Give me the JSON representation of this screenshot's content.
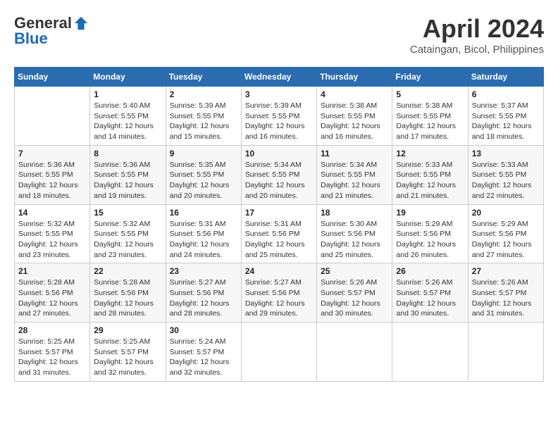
{
  "header": {
    "logo_general": "General",
    "logo_blue": "Blue",
    "month_year": "April 2024",
    "location": "Cataingan, Bicol, Philippines"
  },
  "days_of_week": [
    "Sunday",
    "Monday",
    "Tuesday",
    "Wednesday",
    "Thursday",
    "Friday",
    "Saturday"
  ],
  "weeks": [
    [
      {
        "num": "",
        "detail": ""
      },
      {
        "num": "1",
        "detail": "Sunrise: 5:40 AM\nSunset: 5:55 PM\nDaylight: 12 hours\nand 14 minutes."
      },
      {
        "num": "2",
        "detail": "Sunrise: 5:39 AM\nSunset: 5:55 PM\nDaylight: 12 hours\nand 15 minutes."
      },
      {
        "num": "3",
        "detail": "Sunrise: 5:39 AM\nSunset: 5:55 PM\nDaylight: 12 hours\nand 16 minutes."
      },
      {
        "num": "4",
        "detail": "Sunrise: 5:38 AM\nSunset: 5:55 PM\nDaylight: 12 hours\nand 16 minutes."
      },
      {
        "num": "5",
        "detail": "Sunrise: 5:38 AM\nSunset: 5:55 PM\nDaylight: 12 hours\nand 17 minutes."
      },
      {
        "num": "6",
        "detail": "Sunrise: 5:37 AM\nSunset: 5:55 PM\nDaylight: 12 hours\nand 18 minutes."
      }
    ],
    [
      {
        "num": "7",
        "detail": "Sunrise: 5:36 AM\nSunset: 5:55 PM\nDaylight: 12 hours\nand 18 minutes."
      },
      {
        "num": "8",
        "detail": "Sunrise: 5:36 AM\nSunset: 5:55 PM\nDaylight: 12 hours\nand 19 minutes."
      },
      {
        "num": "9",
        "detail": "Sunrise: 5:35 AM\nSunset: 5:55 PM\nDaylight: 12 hours\nand 20 minutes."
      },
      {
        "num": "10",
        "detail": "Sunrise: 5:34 AM\nSunset: 5:55 PM\nDaylight: 12 hours\nand 20 minutes."
      },
      {
        "num": "11",
        "detail": "Sunrise: 5:34 AM\nSunset: 5:55 PM\nDaylight: 12 hours\nand 21 minutes."
      },
      {
        "num": "12",
        "detail": "Sunrise: 5:33 AM\nSunset: 5:55 PM\nDaylight: 12 hours\nand 21 minutes."
      },
      {
        "num": "13",
        "detail": "Sunrise: 5:33 AM\nSunset: 5:55 PM\nDaylight: 12 hours\nand 22 minutes."
      }
    ],
    [
      {
        "num": "14",
        "detail": "Sunrise: 5:32 AM\nSunset: 5:55 PM\nDaylight: 12 hours\nand 23 minutes."
      },
      {
        "num": "15",
        "detail": "Sunrise: 5:32 AM\nSunset: 5:55 PM\nDaylight: 12 hours\nand 23 minutes."
      },
      {
        "num": "16",
        "detail": "Sunrise: 5:31 AM\nSunset: 5:56 PM\nDaylight: 12 hours\nand 24 minutes."
      },
      {
        "num": "17",
        "detail": "Sunrise: 5:31 AM\nSunset: 5:56 PM\nDaylight: 12 hours\nand 25 minutes."
      },
      {
        "num": "18",
        "detail": "Sunrise: 5:30 AM\nSunset: 5:56 PM\nDaylight: 12 hours\nand 25 minutes."
      },
      {
        "num": "19",
        "detail": "Sunrise: 5:29 AM\nSunset: 5:56 PM\nDaylight: 12 hours\nand 26 minutes."
      },
      {
        "num": "20",
        "detail": "Sunrise: 5:29 AM\nSunset: 5:56 PM\nDaylight: 12 hours\nand 27 minutes."
      }
    ],
    [
      {
        "num": "21",
        "detail": "Sunrise: 5:28 AM\nSunset: 5:56 PM\nDaylight: 12 hours\nand 27 minutes."
      },
      {
        "num": "22",
        "detail": "Sunrise: 5:28 AM\nSunset: 5:56 PM\nDaylight: 12 hours\nand 28 minutes."
      },
      {
        "num": "23",
        "detail": "Sunrise: 5:27 AM\nSunset: 5:56 PM\nDaylight: 12 hours\nand 28 minutes."
      },
      {
        "num": "24",
        "detail": "Sunrise: 5:27 AM\nSunset: 5:56 PM\nDaylight: 12 hours\nand 29 minutes."
      },
      {
        "num": "25",
        "detail": "Sunrise: 5:26 AM\nSunset: 5:57 PM\nDaylight: 12 hours\nand 30 minutes."
      },
      {
        "num": "26",
        "detail": "Sunrise: 5:26 AM\nSunset: 5:57 PM\nDaylight: 12 hours\nand 30 minutes."
      },
      {
        "num": "27",
        "detail": "Sunrise: 5:26 AM\nSunset: 5:57 PM\nDaylight: 12 hours\nand 31 minutes."
      }
    ],
    [
      {
        "num": "28",
        "detail": "Sunrise: 5:25 AM\nSunset: 5:57 PM\nDaylight: 12 hours\nand 31 minutes."
      },
      {
        "num": "29",
        "detail": "Sunrise: 5:25 AM\nSunset: 5:57 PM\nDaylight: 12 hours\nand 32 minutes."
      },
      {
        "num": "30",
        "detail": "Sunrise: 5:24 AM\nSunset: 5:57 PM\nDaylight: 12 hours\nand 32 minutes."
      },
      {
        "num": "",
        "detail": ""
      },
      {
        "num": "",
        "detail": ""
      },
      {
        "num": "",
        "detail": ""
      },
      {
        "num": "",
        "detail": ""
      }
    ]
  ]
}
